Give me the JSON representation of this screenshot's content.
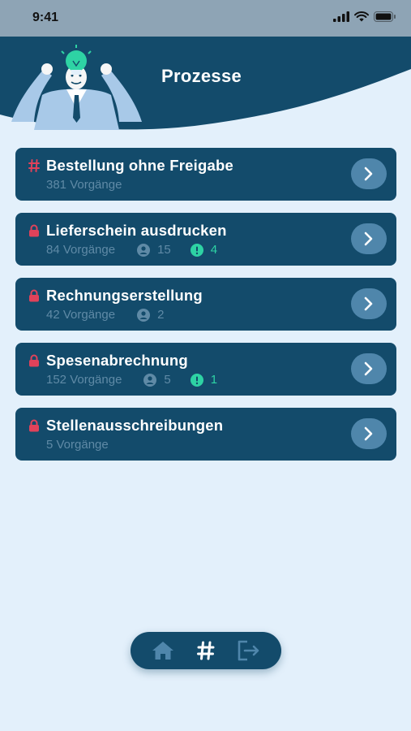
{
  "status_bar": {
    "time": "9:41"
  },
  "header": {
    "title": "Prozesse"
  },
  "processes": [
    {
      "title": "Bestellung ohne Freigabe",
      "icon": "hash-icon",
      "count": "381 Vorgänge",
      "users": null,
      "alerts": null
    },
    {
      "title": "Lieferschein ausdrucken",
      "icon": "lock-icon",
      "count": "84 Vorgänge",
      "users": "15",
      "alerts": "4"
    },
    {
      "title": "Rechnungserstellung",
      "icon": "lock-icon",
      "count": "42 Vorgänge",
      "users": "2",
      "alerts": null
    },
    {
      "title": "Spesenabrechnung",
      "icon": "lock-icon",
      "count": "152 Vorgänge",
      "users": "5",
      "alerts": "1"
    },
    {
      "title": "Stellenausschreibungen",
      "icon": "lock-icon",
      "count": "5 Vorgänge",
      "users": null,
      "alerts": null
    }
  ],
  "bottom_nav": [
    {
      "icon": "home-icon"
    },
    {
      "icon": "hash-icon"
    },
    {
      "icon": "logout-icon"
    }
  ],
  "colors": {
    "primary": "#134b6b",
    "background": "#e3f0fb",
    "accent_red": "#e0425a",
    "accent_green": "#2ed3a4",
    "muted_text": "#5f8aa6",
    "arrow_button": "#4f86ab"
  }
}
